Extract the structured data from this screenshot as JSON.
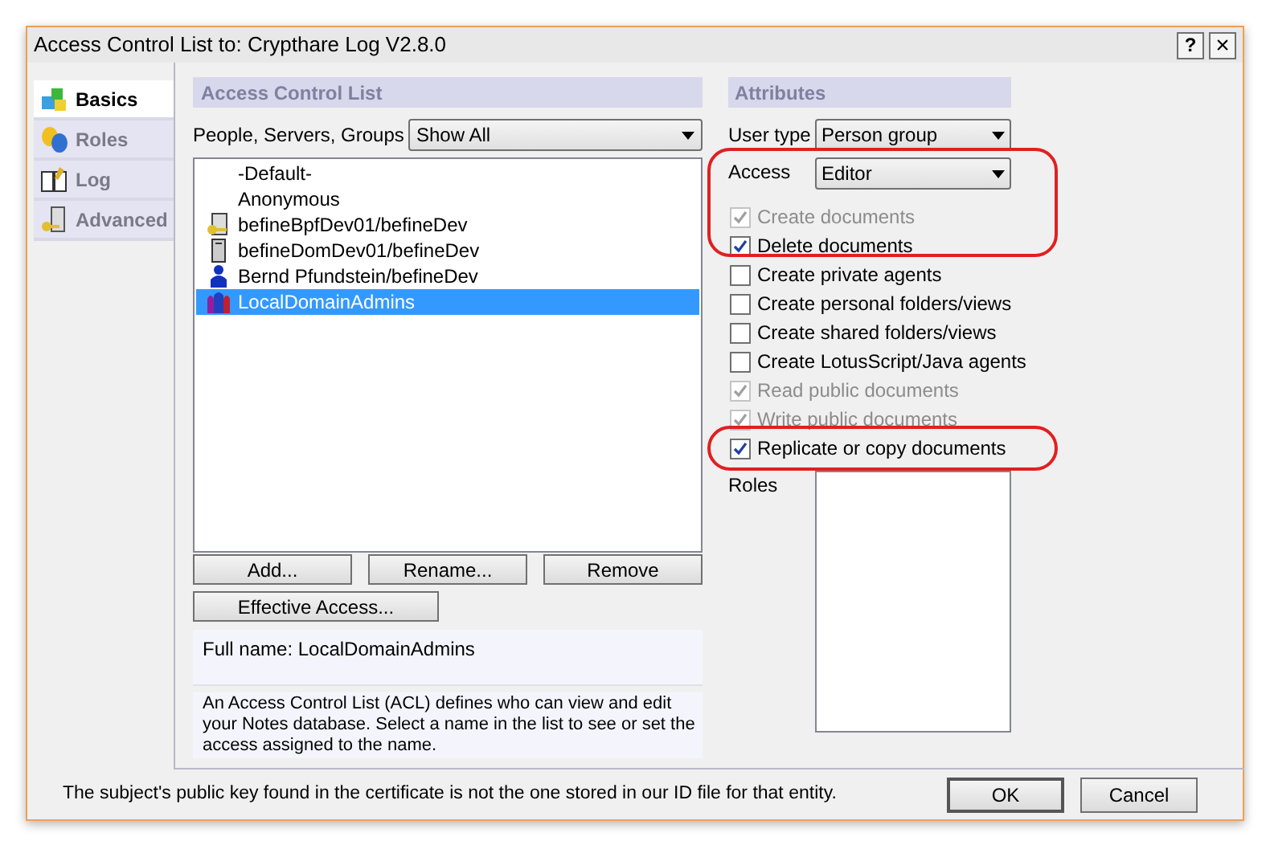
{
  "window": {
    "title": "Access Control List to: Crypthare Log V2.8.0",
    "help": "?",
    "close": "×"
  },
  "nav": [
    {
      "label": "Basics",
      "kind": "blocks",
      "selected": true
    },
    {
      "label": "Roles",
      "kind": "masks",
      "selected": false
    },
    {
      "label": "Log",
      "kind": "book",
      "selected": false
    },
    {
      "label": "Advanced",
      "kind": "key",
      "selected": false
    }
  ],
  "acl": {
    "heading": "Access Control List",
    "filter_label": "People, Servers, Groups",
    "filter": "Show All",
    "entries": [
      {
        "name": "-Default-",
        "kind": "none",
        "selected": false
      },
      {
        "name": "Anonymous",
        "kind": "none",
        "selected": false
      },
      {
        "name": "befineBpfDev01/befineDev",
        "kind": "server-key",
        "selected": false
      },
      {
        "name": "befineDomDev01/befineDev",
        "kind": "server",
        "selected": false
      },
      {
        "name": "Bernd Pfundstein/befineDev",
        "kind": "person",
        "selected": false
      },
      {
        "name": "LocalDomainAdmins",
        "kind": "group",
        "selected": true
      }
    ],
    "buttons": [
      "Add...",
      "Rename...",
      "Remove"
    ],
    "effective_button": "Effective Access...",
    "full_name": "Full name: LocalDomainAdmins",
    "description": "An Access Control List (ACL) defines who can view and edit your Notes database.  Select a name in the list to see or set the access assigned to the name."
  },
  "attributes": {
    "heading": "Attributes",
    "user_type_label": "User type",
    "user_type": "Person group",
    "access_label": "Access",
    "access": "Editor",
    "options": [
      {
        "label": "Create documents",
        "checked": true,
        "disabled": true
      },
      {
        "label": "Delete documents",
        "checked": true,
        "disabled": false
      },
      {
        "label": "Create private agents",
        "checked": false,
        "disabled": false
      },
      {
        "label": "Create personal folders/views",
        "checked": false,
        "disabled": false
      },
      {
        "label": "Create shared folders/views",
        "checked": false,
        "disabled": false
      },
      {
        "label": "Create LotusScript/Java agents",
        "checked": false,
        "disabled": false
      },
      {
        "label": "Read public documents",
        "checked": true,
        "disabled": true
      },
      {
        "label": "Write public documents",
        "checked": true,
        "disabled": true
      },
      {
        "label": "Replicate or copy documents",
        "checked": true,
        "disabled": false
      }
    ],
    "roles_label": "Roles"
  },
  "status": "The subject's public key found in the certificate is not the one stored in our ID file for that entity.",
  "buttons": [
    "OK",
    "Cancel"
  ]
}
